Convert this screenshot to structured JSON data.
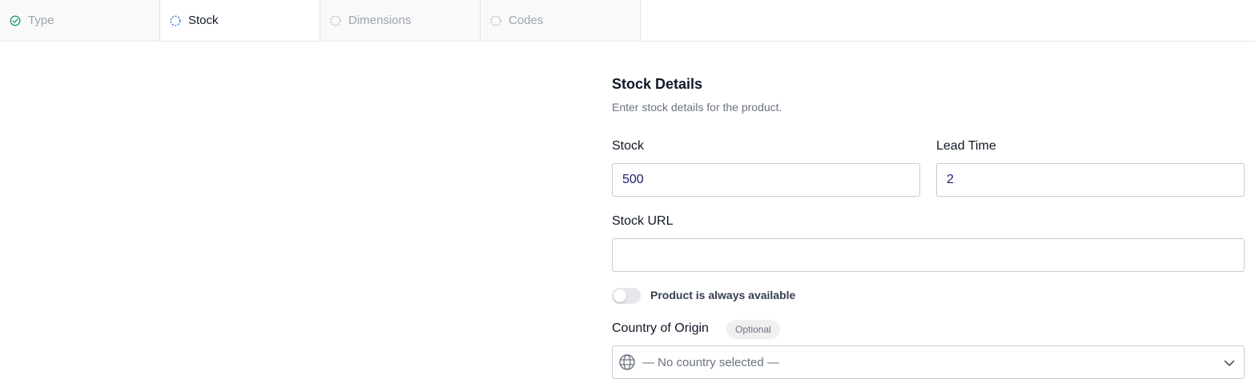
{
  "tabs": [
    {
      "label": "Type",
      "state": "complete"
    },
    {
      "label": "Stock",
      "state": "active"
    },
    {
      "label": "Dimensions",
      "state": "pending"
    },
    {
      "label": "Codes",
      "state": "pending"
    }
  ],
  "section": {
    "title": "Stock Details",
    "subtitle": "Enter stock details for the product."
  },
  "fields": {
    "stock": {
      "label": "Stock",
      "value": "500"
    },
    "lead_time": {
      "label": "Lead Time",
      "value": "2"
    },
    "stock_url": {
      "label": "Stock URL",
      "value": ""
    }
  },
  "availability": {
    "label": "Product is always available",
    "enabled": false
  },
  "country": {
    "label": "Country of Origin",
    "badge": "Optional",
    "selected": "— No country selected —"
  },
  "colors": {
    "complete": "#22a06b",
    "active": "#2f7fd8",
    "pending": "#b5b9bf"
  },
  "icons": {
    "complete": "check-circle-icon",
    "active": "dashed-circle-icon",
    "pending": "dashed-circle-icon",
    "select": "globe-icon",
    "dropdown": "chevron-down-icon"
  }
}
